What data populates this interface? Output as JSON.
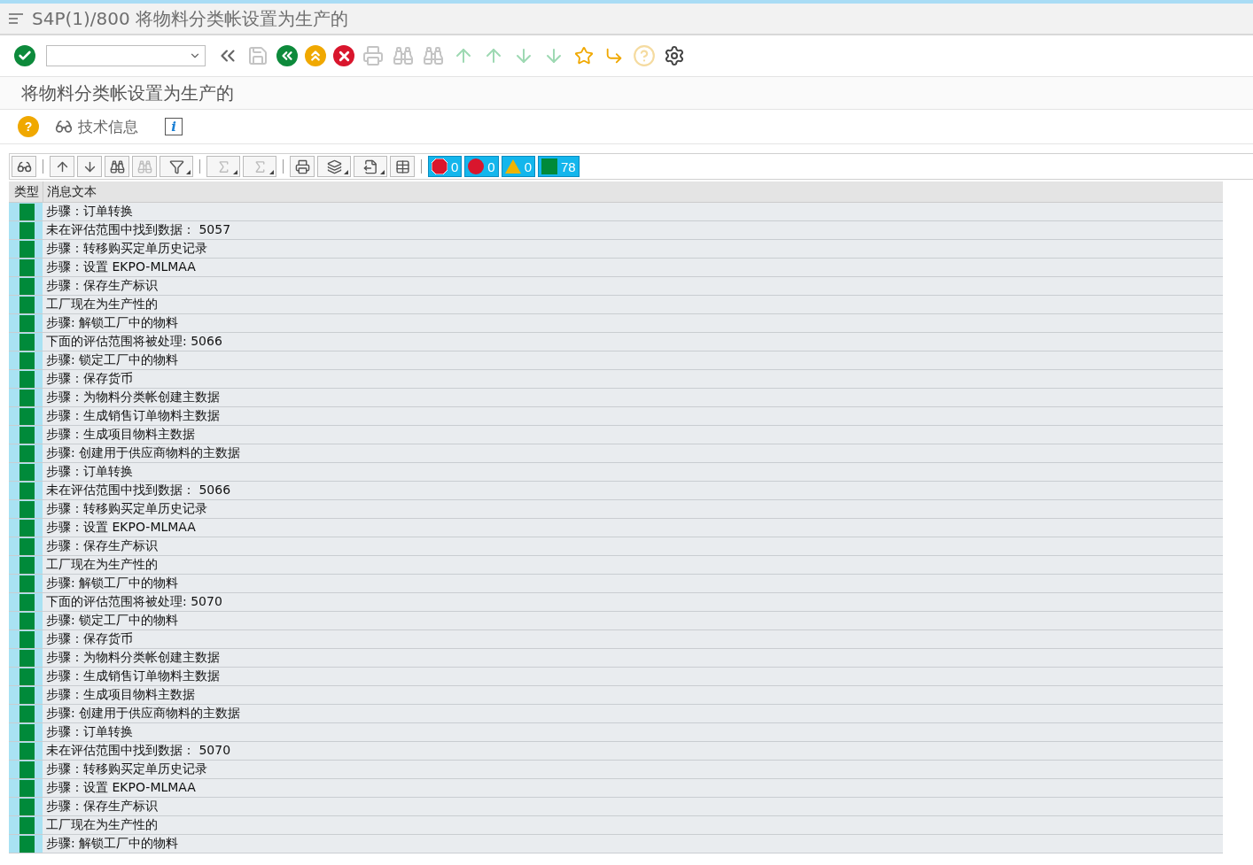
{
  "window": {
    "title": "S4P(1)/800 将物料分类帐设置为生产的"
  },
  "toolbar": [
    {
      "kind": "enter",
      "disabled": false
    },
    {
      "kind": "command"
    },
    {
      "kind": "collapse",
      "disabled": false
    },
    {
      "kind": "save",
      "disabled": true
    },
    {
      "kind": "back",
      "disabled": false
    },
    {
      "kind": "exit",
      "disabled": false
    },
    {
      "kind": "cancel",
      "disabled": false
    },
    {
      "kind": "print",
      "disabled": true
    },
    {
      "kind": "find",
      "disabled": true
    },
    {
      "kind": "findnext",
      "disabled": true
    },
    {
      "kind": "first",
      "disabled": true
    },
    {
      "kind": "prev",
      "disabled": true
    },
    {
      "kind": "next",
      "disabled": true
    },
    {
      "kind": "last",
      "disabled": true
    },
    {
      "kind": "session",
      "disabled": false
    },
    {
      "kind": "shortcut",
      "disabled": false
    },
    {
      "kind": "help",
      "disabled": true
    },
    {
      "kind": "settings",
      "disabled": false
    }
  ],
  "header": {
    "title": "将物料分类帐设置为生产的"
  },
  "app_toolbar": [
    {
      "kind": "help",
      "label": "?"
    },
    {
      "kind": "glasses",
      "label": "技术信息"
    },
    {
      "kind": "info",
      "label": "i"
    }
  ],
  "alv_toolbar": [
    {
      "kind": "details",
      "disabled": false
    },
    {
      "kind": "sep"
    },
    {
      "kind": "sortup",
      "disabled": false
    },
    {
      "kind": "sortdown",
      "disabled": false
    },
    {
      "kind": "find",
      "disabled": false
    },
    {
      "kind": "findnext",
      "disabled": true
    },
    {
      "kind": "filter",
      "disabled": false
    },
    {
      "kind": "sep"
    },
    {
      "kind": "sum",
      "disabled": true
    },
    {
      "kind": "subtotal",
      "disabled": true
    },
    {
      "kind": "sep"
    },
    {
      "kind": "print",
      "disabled": false
    },
    {
      "kind": "view",
      "disabled": false
    },
    {
      "kind": "export",
      "disabled": false
    },
    {
      "kind": "layout",
      "disabled": false
    },
    {
      "kind": "sep"
    }
  ],
  "counters": [
    {
      "kind": "stop",
      "count": "0"
    },
    {
      "kind": "error",
      "count": "0"
    },
    {
      "kind": "warning",
      "count": "0"
    },
    {
      "kind": "success",
      "count": "78"
    }
  ],
  "table": {
    "columns": [
      "类型",
      "消息文本"
    ],
    "rows": [
      {
        "color": "#008a3a",
        "text": "步骤：订单转换"
      },
      {
        "color": "#008a3a",
        "text": "未在评估范围中找到数据： 5057"
      },
      {
        "color": "#008a3a",
        "text": "步骤：转移购买定单历史记录"
      },
      {
        "color": "#008a3a",
        "text": "步骤：设置 EKPO-MLMAA"
      },
      {
        "color": "#008a3a",
        "text": "步骤：保存生产标识"
      },
      {
        "color": "#008a3a",
        "text": "工厂现在为生产性的"
      },
      {
        "color": "#008a3a",
        "text": "步骤: 解锁工厂中的物料"
      },
      {
        "color": "#008a3a",
        "text": "下面的评估范围将被处理: 5066"
      },
      {
        "color": "#008a3a",
        "text": "步骤: 锁定工厂中的物料"
      },
      {
        "color": "#008a3a",
        "text": "步骤：保存货币"
      },
      {
        "color": "#008a3a",
        "text": "步骤：为物料分类帐创建主数据"
      },
      {
        "color": "#008a3a",
        "text": "步骤：生成销售订单物料主数据"
      },
      {
        "color": "#008a3a",
        "text": "步骤：生成项目物料主数据"
      },
      {
        "color": "#008a3a",
        "text": "步骤: 创建用于供应商物料的主数据"
      },
      {
        "color": "#008a3a",
        "text": "步骤：订单转换"
      },
      {
        "color": "#008a3a",
        "text": "未在评估范围中找到数据： 5066"
      },
      {
        "color": "#008a3a",
        "text": "步骤：转移购买定单历史记录"
      },
      {
        "color": "#008a3a",
        "text": "步骤：设置 EKPO-MLMAA"
      },
      {
        "color": "#008a3a",
        "text": "步骤：保存生产标识"
      },
      {
        "color": "#008a3a",
        "text": "工厂现在为生产性的"
      },
      {
        "color": "#008a3a",
        "text": "步骤: 解锁工厂中的物料"
      },
      {
        "color": "#008a3a",
        "text": "下面的评估范围将被处理: 5070"
      },
      {
        "color": "#008a3a",
        "text": "步骤: 锁定工厂中的物料"
      },
      {
        "color": "#008a3a",
        "text": "步骤：保存货币"
      },
      {
        "color": "#008a3a",
        "text": "步骤：为物料分类帐创建主数据"
      },
      {
        "color": "#008a3a",
        "text": "步骤：生成销售订单物料主数据"
      },
      {
        "color": "#008a3a",
        "text": "步骤：生成项目物料主数据"
      },
      {
        "color": "#008a3a",
        "text": "步骤: 创建用于供应商物料的主数据"
      },
      {
        "color": "#008a3a",
        "text": "步骤：订单转换"
      },
      {
        "color": "#008a3a",
        "text": "未在评估范围中找到数据： 5070"
      },
      {
        "color": "#008a3a",
        "text": "步骤：转移购买定单历史记录"
      },
      {
        "color": "#008a3a",
        "text": "步骤：设置 EKPO-MLMAA"
      },
      {
        "color": "#008a3a",
        "text": "步骤：保存生产标识"
      },
      {
        "color": "#008a3a",
        "text": "工厂现在为生产性的"
      },
      {
        "color": "#008a3a",
        "text": "步骤: 解锁工厂中的物料"
      }
    ]
  }
}
